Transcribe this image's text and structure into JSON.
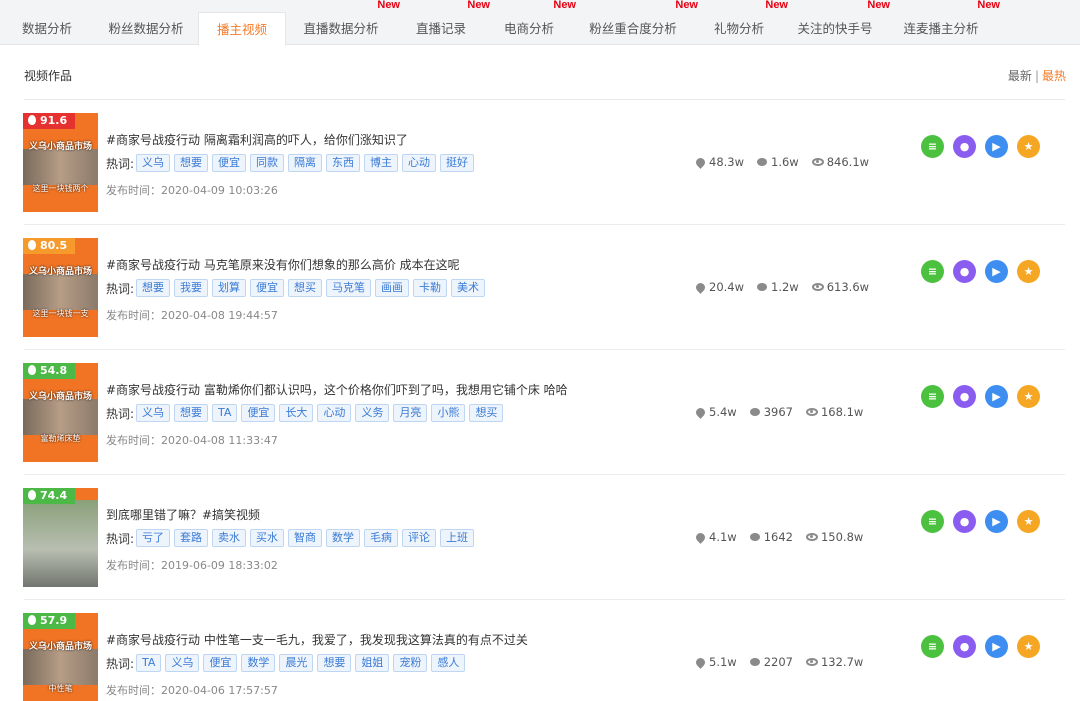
{
  "tabs": [
    {
      "label": "数据分析",
      "new": ""
    },
    {
      "label": "粉丝数据分析",
      "new": ""
    },
    {
      "label": "播主视频",
      "new": ""
    },
    {
      "label": "直播数据分析",
      "new": "New"
    },
    {
      "label": "直播记录",
      "new": "New"
    },
    {
      "label": "电商分析",
      "new": "New"
    },
    {
      "label": "粉丝重合度分析",
      "new": "New"
    },
    {
      "label": "礼物分析",
      "new": "New"
    },
    {
      "label": "关注的快手号",
      "new": "New"
    },
    {
      "label": "连麦播主分析",
      "new": "New"
    }
  ],
  "section": {
    "title": "视频作品",
    "sort_latest": "最新",
    "sort_sep": "|",
    "sort_hot": "最热"
  },
  "labels": {
    "hot_words": "热词:"
  },
  "icons": {
    "score": "flame-icon",
    "likes": "heart-icon",
    "comments": "comment-icon",
    "views": "eye-icon",
    "action1": "list-icon",
    "action2": "users-icon",
    "action3": "play-icon",
    "action4": "star-icon"
  },
  "videos": [
    {
      "score": "91.6",
      "score_color": "#e5312f",
      "thumb_top": "义乌小商品市场",
      "thumb_bottom": "这里一块钱两个",
      "title": "#商家号战疫行动 隔离霜利润高的吓人，给你们涨知识了",
      "tags": [
        "义乌",
        "想要",
        "便宜",
        "同款",
        "隔离",
        "东西",
        "博主",
        "心动",
        "挺好"
      ],
      "time": "发布时间：2020-04-09 10:03:26",
      "likes": "48.3w",
      "comments": "1.6w",
      "views": "846.1w"
    },
    {
      "score": "80.5",
      "score_color": "#f79a2c",
      "thumb_top": "义乌小商品市场",
      "thumb_bottom": "这里一块钱一支",
      "title": "#商家号战疫行动 马克笔原来没有你们想象的那么高价 成本在这呢",
      "tags": [
        "想要",
        "我要",
        "划算",
        "便宜",
        "想买",
        "马克笔",
        "画画",
        "卡勒",
        "美术"
      ],
      "time": "发布时间：2020-04-08 19:44:57",
      "likes": "20.4w",
      "comments": "1.2w",
      "views": "613.6w"
    },
    {
      "score": "54.8",
      "score_color": "#4cb846",
      "thumb_top": "义乌小商品市场",
      "thumb_bottom": "富勒烯床垫",
      "title": "#商家号战疫行动 富勒烯你们都认识吗，这个价格你们吓到了吗，我想用它铺个床 哈哈",
      "tags": [
        "义乌",
        "想要",
        "TA",
        "便宜",
        "长大",
        "心动",
        "义务",
        "月亮",
        "小熊",
        "想买"
      ],
      "time": "发布时间：2020-04-08 11:33:47",
      "likes": "5.4w",
      "comments": "3967",
      "views": "168.1w"
    },
    {
      "score": "74.4",
      "score_color": "#4cb846",
      "thumb_top": "",
      "thumb_bottom": "",
      "title": "到底哪里错了嘛？#搞笑视频",
      "tags": [
        "亏了",
        "套路",
        "卖水",
        "买水",
        "智商",
        "数学",
        "毛病",
        "评论",
        "上班"
      ],
      "time": "发布时间：2019-06-09 18:33:02",
      "likes": "4.1w",
      "comments": "1642",
      "views": "150.8w"
    },
    {
      "score": "57.9",
      "score_color": "#4cb846",
      "thumb_top": "义乌小商品市场",
      "thumb_bottom": "中性笔",
      "title": "#商家号战疫行动 中性笔一支一毛九，我爱了，我发现我这算法真的有点不过关",
      "tags": [
        "TA",
        "义乌",
        "便宜",
        "数学",
        "晨光",
        "想要",
        "姐姐",
        "宠粉",
        "感人"
      ],
      "time": "发布时间：2020-04-06 17:57:57",
      "likes": "5.1w",
      "comments": "2207",
      "views": "132.7w"
    }
  ]
}
